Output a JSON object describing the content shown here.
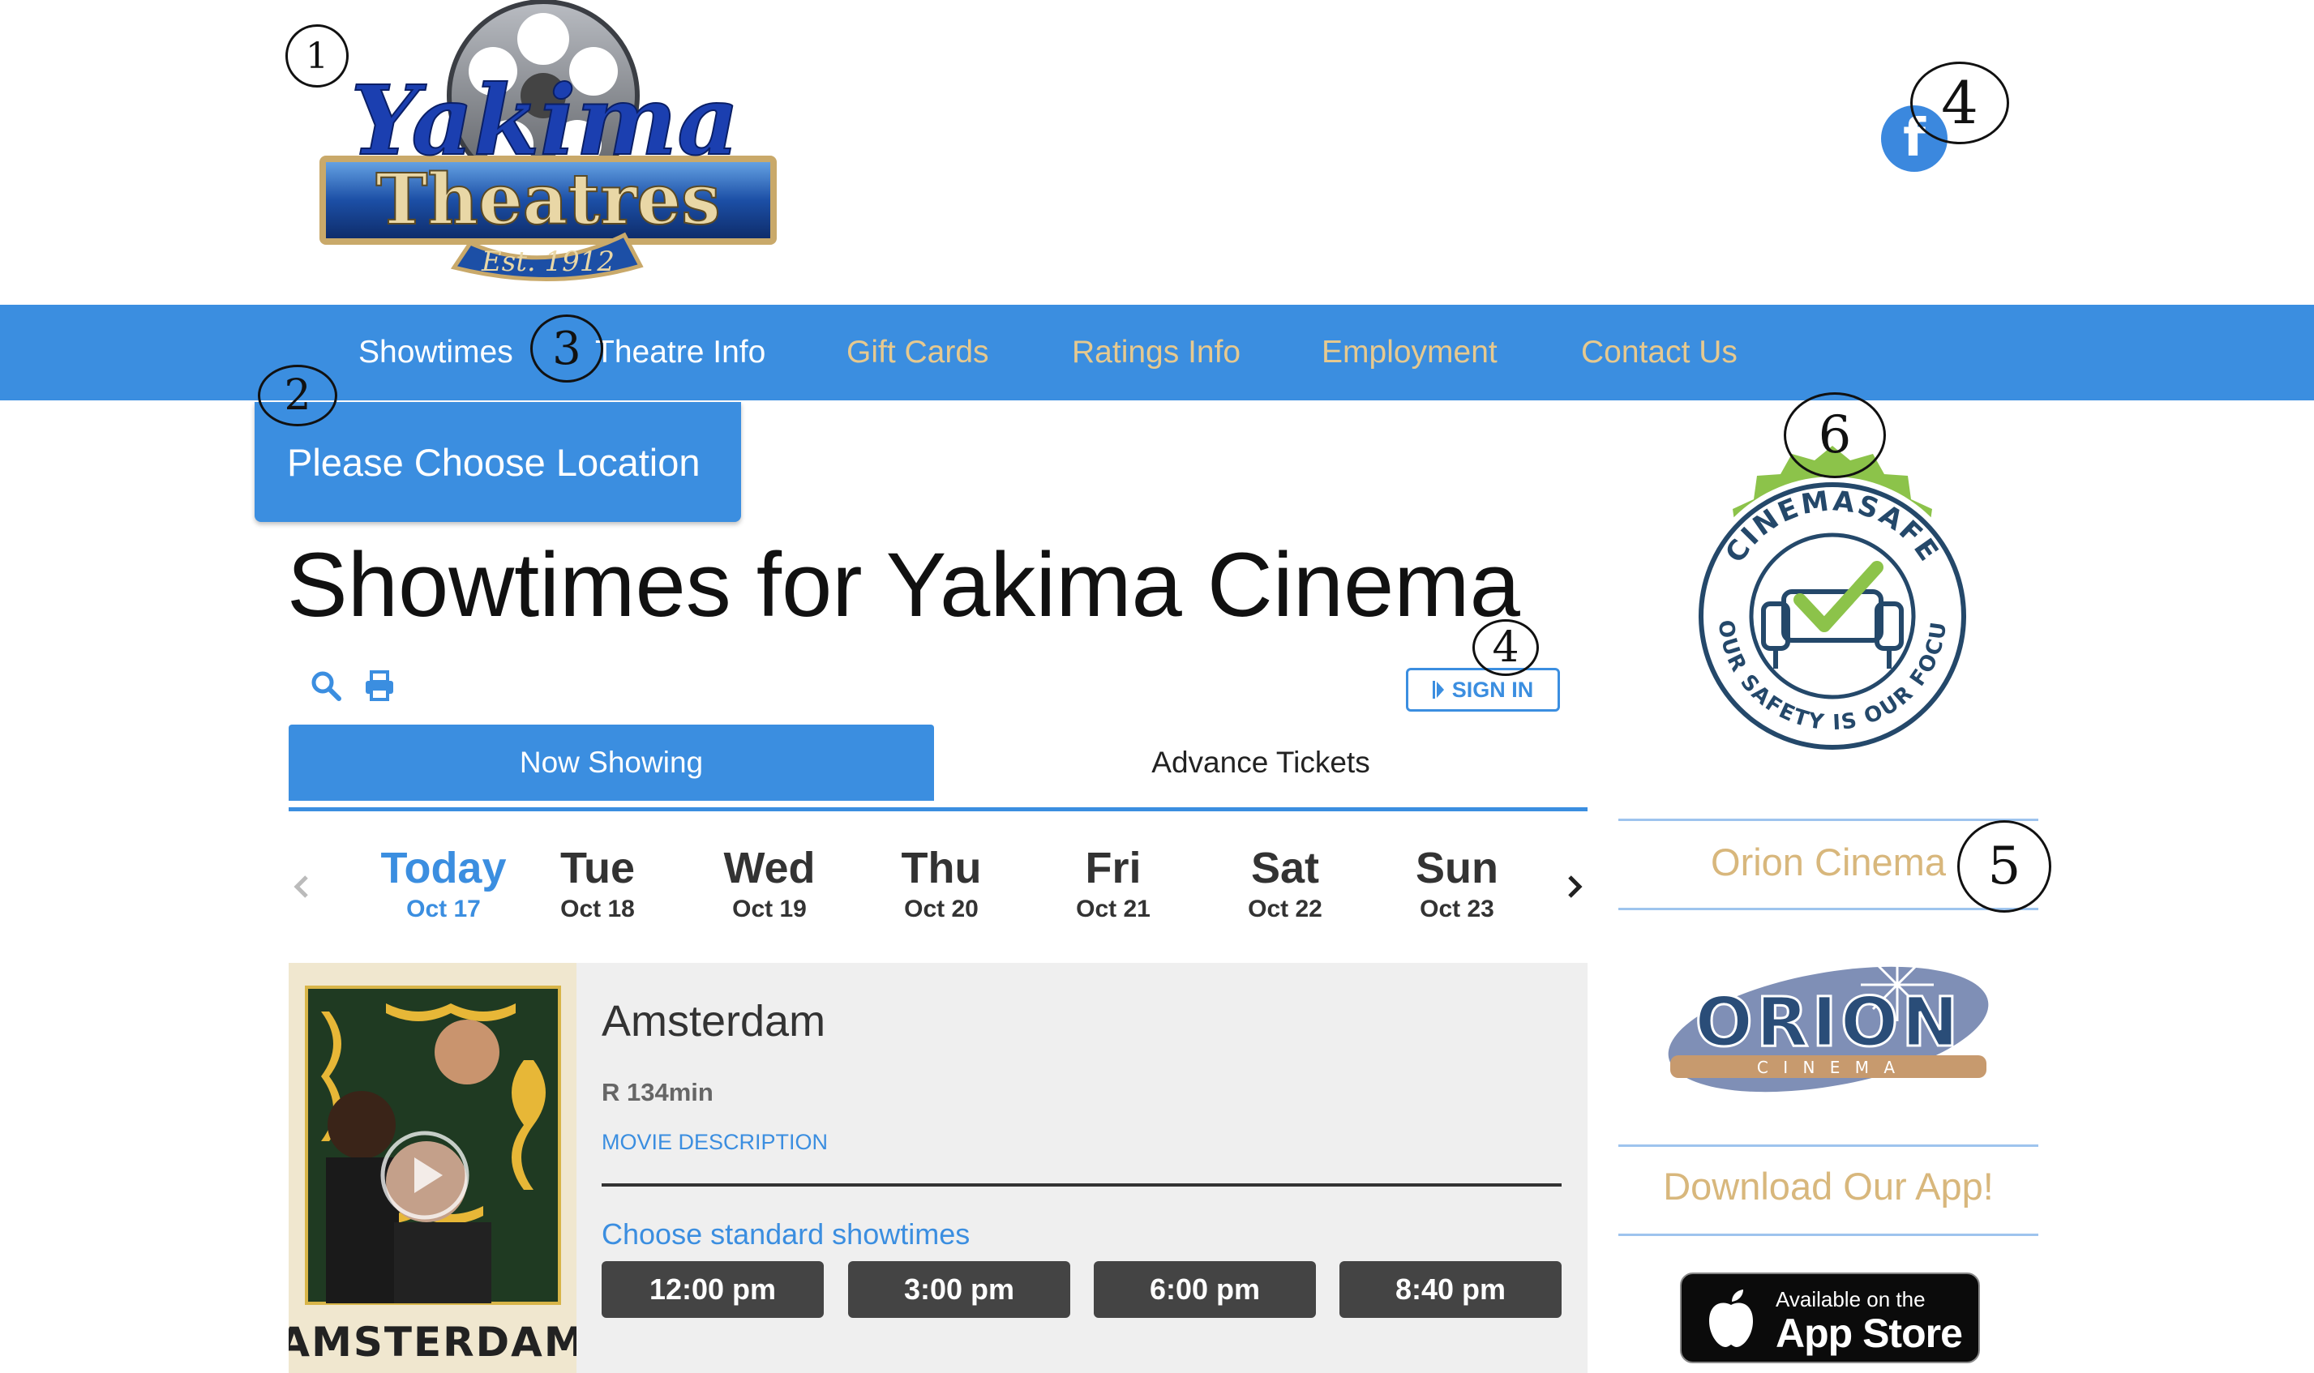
{
  "header": {
    "logo": {
      "line1": "Yakima",
      "line2": "Theatres",
      "ribbon": "Est. 1912"
    },
    "facebook_icon": "facebook-icon"
  },
  "annotations": [
    "1",
    "4",
    "3",
    "2",
    "6",
    "4",
    "5"
  ],
  "nav": {
    "items": [
      {
        "label": "Showtimes",
        "color": "#ffffff"
      },
      {
        "label": "Theatre Info",
        "color": "#ffffff"
      },
      {
        "label": "Gift Cards",
        "color": "#e6c98f"
      },
      {
        "label": "Ratings Info",
        "color": "#e6c98f"
      },
      {
        "label": "Employment",
        "color": "#e6c98f"
      },
      {
        "label": "Contact Us",
        "color": "#e6c98f"
      }
    ]
  },
  "location_button": "Please Choose Location",
  "page_title": "Showtimes for Yakima Cinema",
  "toolbar": {
    "search_icon": "search-icon",
    "print_icon": "print-icon",
    "signin_label": "SIGN IN"
  },
  "tabs": [
    {
      "label": "Now Showing",
      "active": true
    },
    {
      "label": "Advance Tickets",
      "active": false
    }
  ],
  "dates": [
    {
      "day": "Today",
      "date": "Oct 17",
      "active": true
    },
    {
      "day": "Tue",
      "date": "Oct 18"
    },
    {
      "day": "Wed",
      "date": "Oct 19"
    },
    {
      "day": "Thu",
      "date": "Oct 20"
    },
    {
      "day": "Fri",
      "date": "Oct 21"
    },
    {
      "day": "Sat",
      "date": "Oct 22"
    },
    {
      "day": "Sun",
      "date": "Oct 23"
    }
  ],
  "movie": {
    "title": "Amsterdam",
    "meta": "R 134min",
    "description_link": "MOVIE DESCRIPTION",
    "poster_title": "AMSTERDAM",
    "showtimes_label": "Choose standard showtimes",
    "showtimes": [
      "12:00 pm",
      "3:00 pm",
      "6:00 pm",
      "8:40 pm"
    ]
  },
  "sidebar": {
    "badge": {
      "top": "CINEMASAFE",
      "bottom": "YOUR SAFETY IS OUR FOCUS"
    },
    "orion_label": "Orion Cinema",
    "orion_logo": {
      "name": "ORION",
      "sub": "C I N E M A"
    },
    "app_label": "Download Our App!",
    "appstore": {
      "small": "Available on the",
      "big": "App Store"
    }
  },
  "colors": {
    "accent": "#3b8ee0",
    "gold": "#e6c98f",
    "badge_green": "#8cc34a",
    "badge_navy": "#24486a"
  }
}
